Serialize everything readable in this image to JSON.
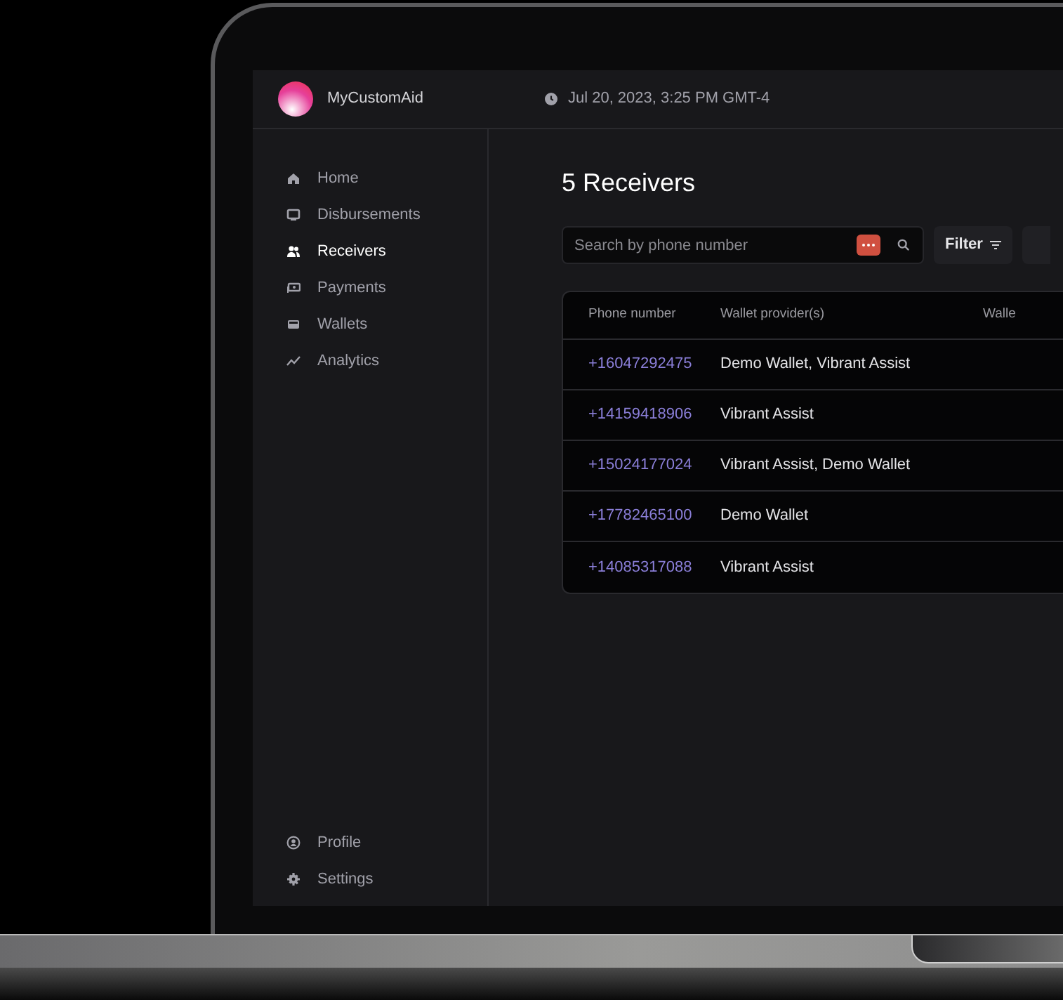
{
  "header": {
    "app_name": "MyCustomAid",
    "datetime": "Jul 20, 2023, 3:25 PM GMT-4"
  },
  "sidebar": {
    "items": [
      {
        "label": "Home",
        "kind": "home",
        "selected": false
      },
      {
        "label": "Disbursements",
        "kind": "disbursements",
        "selected": false
      },
      {
        "label": "Receivers",
        "kind": "receivers",
        "selected": true
      },
      {
        "label": "Payments",
        "kind": "payments",
        "selected": false
      },
      {
        "label": "Wallets",
        "kind": "wallets",
        "selected": false
      },
      {
        "label": "Analytics",
        "kind": "analytics",
        "selected": false
      }
    ],
    "bottom_items": [
      {
        "label": "Profile",
        "kind": "profile",
        "selected": false
      },
      {
        "label": "Settings",
        "kind": "settings",
        "selected": false
      }
    ]
  },
  "page_title": "5 Receivers",
  "search": {
    "placeholder": "Search by phone number"
  },
  "filter_button": {
    "label": "Filter"
  },
  "table": {
    "columns": [
      "Phone number",
      "Wallet provider(s)",
      "Walle"
    ],
    "rows": [
      {
        "phone": "+16047292475",
        "wallets": "Demo Wallet, Vibrant Assist"
      },
      {
        "phone": "+14159418906",
        "wallets": "Vibrant Assist"
      },
      {
        "phone": "+15024177024",
        "wallets": "Vibrant Assist, Demo Wallet"
      },
      {
        "phone": "+17782465100",
        "wallets": "Demo Wallet"
      },
      {
        "phone": "+14085317088",
        "wallets": "Vibrant Assist"
      }
    ]
  }
}
